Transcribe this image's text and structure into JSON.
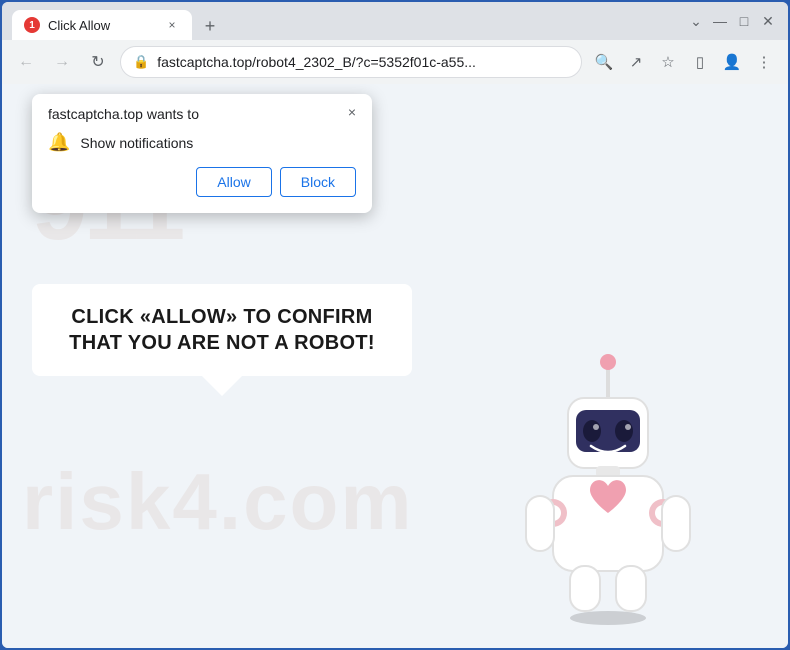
{
  "browser": {
    "tab": {
      "favicon_number": "1",
      "title": "Click Allow",
      "close_label": "×"
    },
    "new_tab_label": "+",
    "window_controls": {
      "chevron_down": "⌄",
      "minimize": "—",
      "restore": "□",
      "close": "✕"
    },
    "nav": {
      "back_label": "←",
      "forward_label": "→",
      "reload_label": "↻"
    },
    "address_bar": {
      "lock_icon": "🔒",
      "url": "fastcaptcha.top/robot4_2302_B/?c=5352f01c-a55..."
    },
    "toolbar_icons": {
      "search": "🔍",
      "share": "↗",
      "bookmark": "☆",
      "split": "▯",
      "profile": "👤",
      "menu": "⋮"
    }
  },
  "notification_popup": {
    "site": "fastcaptcha.top wants to",
    "permission_icon": "🔔",
    "permission_text": "Show notifications",
    "close_label": "×",
    "allow_label": "Allow",
    "block_label": "Block"
  },
  "main_message": {
    "text": "CLICK «ALLOW» TO CONFIRM THAT YOU ARE NOT A ROBOT!"
  },
  "watermark": {
    "top_text": "911",
    "bottom_text": "risk4.com"
  },
  "colors": {
    "browser_border": "#2a5db0",
    "allow_btn": "#1a73e8",
    "block_btn": "#1a73e8",
    "tab_favicon_bg": "#e53935"
  }
}
